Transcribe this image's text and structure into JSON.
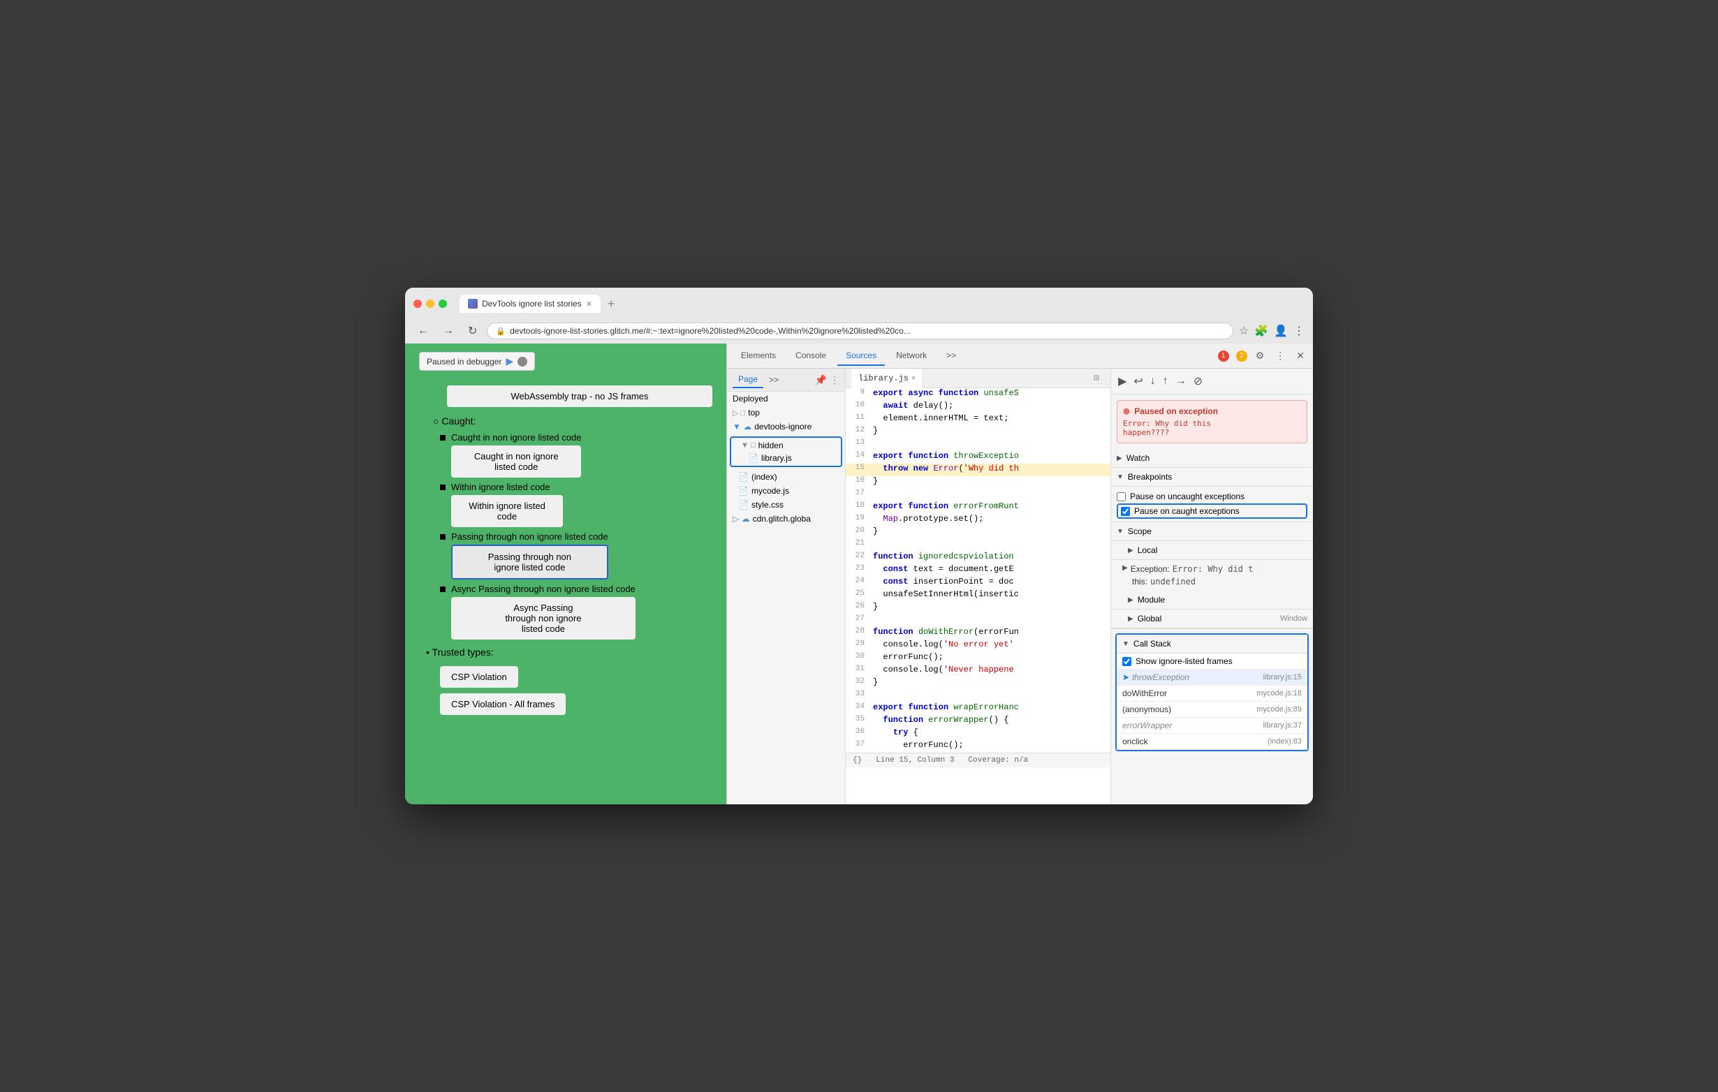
{
  "browser": {
    "tab_title": "DevTools ignore list stories",
    "url": "devtools-ignore-list-stories.glitch.me/#:~:text=ignore%20listed%20code-,Within%20ignore%20listed%20co...",
    "nav_back": "←",
    "nav_forward": "→",
    "nav_refresh": "↻"
  },
  "debugger_badge": "Paused in debugger",
  "webpage": {
    "webassembly_text": "WebAssembly trap -\nno JS frames",
    "caught_title": "Caught:",
    "items": [
      {
        "label": "Caught in non ignore listed code",
        "box_text": "Caught in non ignore\nlisted code",
        "selected": false
      },
      {
        "label": "Within ignore listed code",
        "box_text": "Within ignore listed\ncode",
        "selected": false
      },
      {
        "label": "Passing through non ignore listed code",
        "box_text": "Passing through non\nignore listed code",
        "selected": true
      },
      {
        "label": "Async Passing through non ignore listed code",
        "box_text": "Async Passing\nthrough non ignore\nlisted code",
        "selected": false
      }
    ],
    "trusted_types_title": "Trusted types:",
    "tt_items": [
      "CSP Violation",
      "CSP Violation - All frames"
    ]
  },
  "devtools": {
    "tabs": [
      "Elements",
      "Console",
      "Sources",
      "Network",
      ">>"
    ],
    "active_tab": "Sources",
    "error_count": "1",
    "warn_count": "2",
    "toolbar_icons": [
      "⚙",
      "⋮",
      "✕"
    ]
  },
  "sources": {
    "subtabs": [
      "Page",
      ">>"
    ],
    "active_subtab": "Page",
    "file_tree": {
      "items": [
        {
          "type": "label",
          "name": "Deployed",
          "indent": 0
        },
        {
          "type": "folder",
          "name": "top",
          "indent": 0
        },
        {
          "type": "cloud-folder",
          "name": "devtools-ignore",
          "indent": 0
        },
        {
          "type": "folder",
          "name": "hidden",
          "indent": 1,
          "highlighted": true
        },
        {
          "type": "file",
          "name": "library.js",
          "indent": 2,
          "highlighted": true,
          "color": "orange"
        },
        {
          "type": "file",
          "name": "(index)",
          "indent": 1
        },
        {
          "type": "file",
          "name": "mycode.js",
          "indent": 1,
          "color": "red"
        },
        {
          "type": "file",
          "name": "style.css",
          "indent": 1,
          "color": "red"
        },
        {
          "type": "cloud-folder",
          "name": "cdn.glitch.globa",
          "indent": 0
        }
      ]
    },
    "editor": {
      "active_file": "library.js",
      "lines": [
        {
          "num": 9,
          "content": "export async function unsafeS",
          "highlight": false
        },
        {
          "num": 10,
          "content": "  await delay();",
          "highlight": false
        },
        {
          "num": 11,
          "content": "  element.innerHTML = text;",
          "highlight": false
        },
        {
          "num": 12,
          "content": "}",
          "highlight": false
        },
        {
          "num": 13,
          "content": "",
          "highlight": false
        },
        {
          "num": 14,
          "content": "export function throwExceptio",
          "highlight": false
        },
        {
          "num": 15,
          "content": "  throw new Error('Why did th",
          "highlight": true
        },
        {
          "num": 16,
          "content": "}",
          "highlight": false
        },
        {
          "num": 17,
          "content": "",
          "highlight": false
        },
        {
          "num": 18,
          "content": "export function errorFromRunt",
          "highlight": false
        },
        {
          "num": 19,
          "content": "  Map.prototype.set();",
          "highlight": false
        },
        {
          "num": 20,
          "content": "}",
          "highlight": false
        },
        {
          "num": 21,
          "content": "",
          "highlight": false
        },
        {
          "num": 22,
          "content": "function ignoredcspviolation",
          "highlight": false
        },
        {
          "num": 23,
          "content": "  const text = document.getE",
          "highlight": false
        },
        {
          "num": 24,
          "content": "  const insertionPoint = doc",
          "highlight": false
        },
        {
          "num": 25,
          "content": "  unsafeSetInnerHtml(insertic",
          "highlight": false
        },
        {
          "num": 26,
          "content": "}",
          "highlight": false
        },
        {
          "num": 27,
          "content": "",
          "highlight": false
        },
        {
          "num": 28,
          "content": "function doWithError(errorFun",
          "highlight": false
        },
        {
          "num": 29,
          "content": "  console.log('No error yet'",
          "highlight": false
        },
        {
          "num": 30,
          "content": "  errorFunc();",
          "highlight": false
        },
        {
          "num": 31,
          "content": "  console.log('Never happene",
          "highlight": false
        },
        {
          "num": 32,
          "content": "}",
          "highlight": false
        },
        {
          "num": 33,
          "content": "",
          "highlight": false
        },
        {
          "num": 34,
          "content": "export function wrapErrorHanc",
          "highlight": false
        },
        {
          "num": 35,
          "content": "  function errorWrapper() {",
          "highlight": false
        },
        {
          "num": 36,
          "content": "    try {",
          "highlight": false
        },
        {
          "num": 37,
          "content": "      errorFunc();",
          "highlight": false
        }
      ],
      "status_line": "Line 15, Column 3",
      "status_coverage": "Coverage: n/a"
    }
  },
  "right_panel": {
    "paused_exception": {
      "title": "Paused on exception",
      "message": "Error: Why did this\nhappen????"
    },
    "sections": {
      "watch": "Watch",
      "breakpoints": "Breakpoints",
      "pause_uncaught": "Pause on uncaught exceptions",
      "pause_caught": "Pause on caught exceptions",
      "pause_caught_checked": true,
      "scope": "Scope",
      "local": "Local",
      "exception_label": "Exception:",
      "exception_value": "Error: Why did t",
      "this_label": "this:",
      "this_value": "undefined",
      "module": "Module",
      "global": "Global",
      "global_value": "Window",
      "call_stack": "Call Stack",
      "show_ignored_frames": "Show ignore-listed frames",
      "show_ignored_checked": true,
      "frames": [
        {
          "name": "throwException",
          "location": "library.js:15",
          "active": true,
          "dimmed": true
        },
        {
          "name": "doWithError",
          "location": "mycode.js:18",
          "active": false,
          "dimmed": false
        },
        {
          "name": "(anonymous)",
          "location": "mycode.js:89",
          "active": false,
          "dimmed": false
        },
        {
          "name": "errorWrapper",
          "location": "library.js:37",
          "active": false,
          "dimmed": true
        },
        {
          "name": "onclick",
          "location": "(index):83",
          "active": false,
          "dimmed": false
        }
      ]
    }
  }
}
